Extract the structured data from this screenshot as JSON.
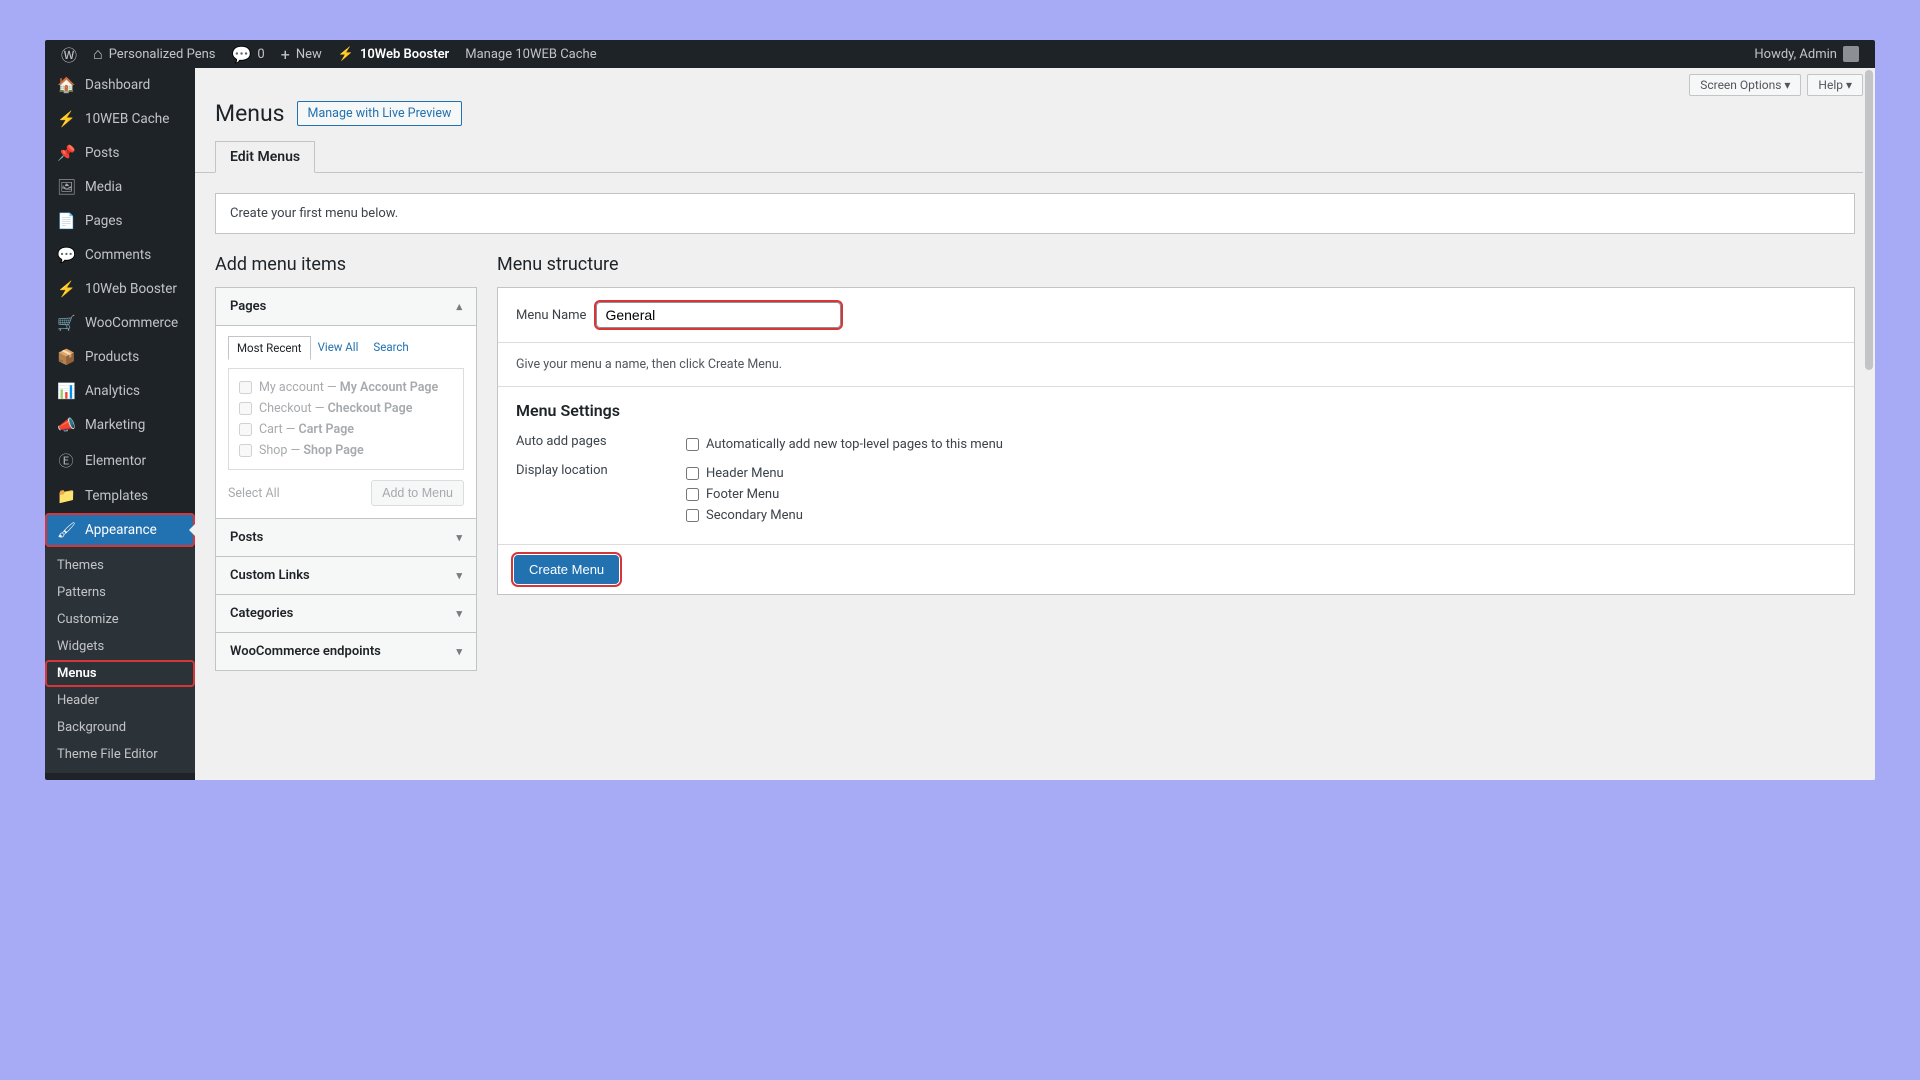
{
  "adminbar": {
    "site_name": "Personalized Pens",
    "comments": "0",
    "new": "New",
    "booster": "10Web Booster",
    "cache": "Manage 10WEB Cache",
    "howdy": "Howdy, Admin"
  },
  "sidebar": {
    "items": [
      {
        "icon": "🏠",
        "label": "Dashboard"
      },
      {
        "icon": "⚡",
        "label": "10WEB Cache"
      },
      {
        "icon": "📌",
        "label": "Posts"
      },
      {
        "icon": "🖼",
        "label": "Media"
      },
      {
        "icon": "📄",
        "label": "Pages"
      },
      {
        "icon": "💬",
        "label": "Comments"
      },
      {
        "icon": "⚡",
        "label": "10Web Booster"
      },
      {
        "icon": "🛒",
        "label": "WooCommerce"
      },
      {
        "icon": "📦",
        "label": "Products"
      },
      {
        "icon": "📊",
        "label": "Analytics"
      },
      {
        "icon": "📣",
        "label": "Marketing"
      },
      {
        "icon": "Ⓔ",
        "label": "Elementor"
      },
      {
        "icon": "📁",
        "label": "Templates"
      },
      {
        "icon": "🖌",
        "label": "Appearance",
        "active": true
      }
    ],
    "submenu": [
      {
        "label": "Themes"
      },
      {
        "label": "Patterns"
      },
      {
        "label": "Customize"
      },
      {
        "label": "Widgets"
      },
      {
        "label": "Menus",
        "current": true
      },
      {
        "label": "Header"
      },
      {
        "label": "Background"
      },
      {
        "label": "Theme File Editor"
      }
    ]
  },
  "content": {
    "screen_options": "Screen Options",
    "help": "Help",
    "title": "Menus",
    "live_preview": "Manage with Live Preview",
    "tab": "Edit Menus",
    "notice": "Create your first menu below.",
    "left_h": "Add menu items",
    "right_h": "Menu structure",
    "accordion": {
      "pages": "Pages",
      "posts": "Posts",
      "custom": "Custom Links",
      "categories": "Categories",
      "woo": "WooCommerce endpoints"
    },
    "minitabs": {
      "recent": "Most Recent",
      "all": "View All",
      "search": "Search"
    },
    "page_items": [
      {
        "a": "My account — ",
        "b": "My Account Page"
      },
      {
        "a": "Checkout — ",
        "b": "Checkout Page"
      },
      {
        "a": "Cart — ",
        "b": "Cart Page"
      },
      {
        "a": "Shop — ",
        "b": "Shop Page"
      }
    ],
    "select_all": "Select All",
    "add_to_menu": "Add to Menu",
    "menu_name_lbl": "Menu Name",
    "menu_name_val": "General",
    "desc": "Give your menu a name, then click Create Menu.",
    "settings_h": "Menu Settings",
    "auto_add_lbl": "Auto add pages",
    "auto_add_opt": "Automatically add new top-level pages to this menu",
    "disp_lbl": "Display location",
    "disp_opts": [
      "Header Menu",
      "Footer Menu",
      "Secondary Menu"
    ],
    "create_btn": "Create Menu"
  }
}
